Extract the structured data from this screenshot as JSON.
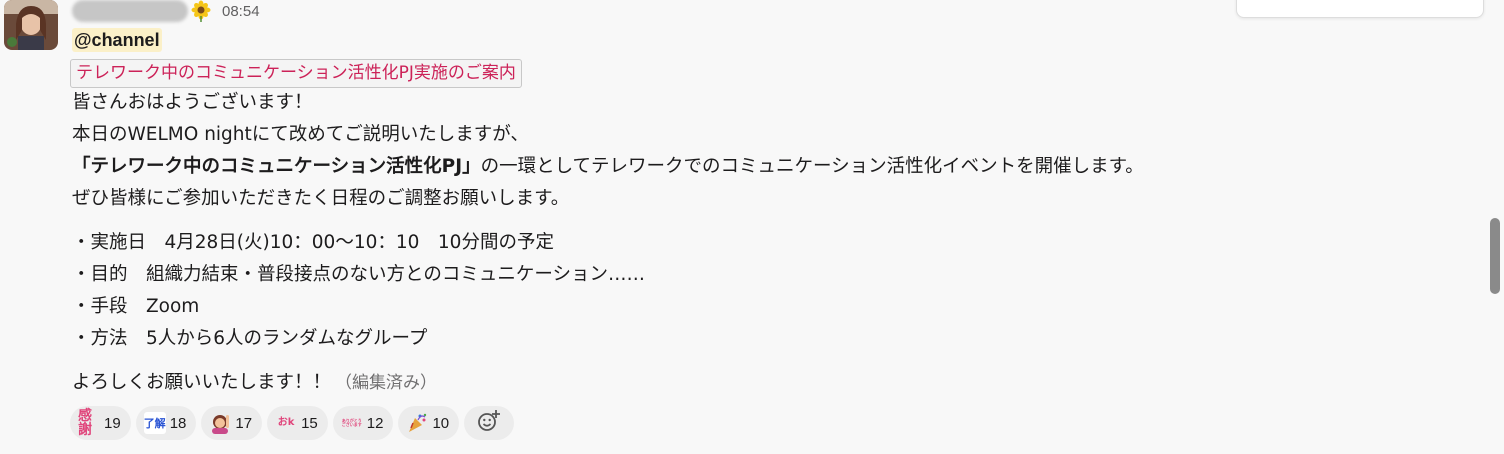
{
  "message": {
    "time": "08:54",
    "mention": "@channel",
    "title_code": "テレワーク中のコミュニケーション活性化PJ実施のご案内",
    "lines": {
      "greeting": "皆さんおはようございます！",
      "intro": "本日のWELMO nightにて改めてご説明いたしますが、",
      "project_bold": "「テレワーク中のコミュニケーション活性化PJ」",
      "project_rest": "の一環としてテレワークでのコミュニケーション活性化イベントを開催します。",
      "request": "ぜひ皆様にご参加いただきたく日程のご調整お願いします。",
      "item_date": "・実施日　4月28日(火)10：00～10：10　10分間の予定",
      "item_purpose": "・目的　組織力結束・普段接点のない方とのコミュニケーション……",
      "item_means": "・手段　Zoom",
      "item_method": "・方法　5人から6人のランダムなグループ",
      "closing": "よろしくお願いいたします！！",
      "edited": "（編集済み）"
    }
  },
  "reactions": [
    {
      "icon": "kansha-emoji",
      "text": "感謝",
      "count": "19",
      "color": "#e0457b"
    },
    {
      "icon": "ryokai-emoji",
      "text": "了解",
      "count": "18",
      "color": "#2b55d4"
    },
    {
      "icon": "person-raising-hand-emoji",
      "text": "",
      "count": "17",
      "color": "#d86f9a"
    },
    {
      "icon": "ok-emoji",
      "text": "おk",
      "count": "15",
      "color": "#e0457b"
    },
    {
      "icon": "arigatou-emoji",
      "text": "ありがとうございます",
      "count": "12",
      "color": "#e0457b"
    },
    {
      "icon": "party-popper-emoji",
      "text": "",
      "count": "10",
      "color": "#e6a23c"
    }
  ],
  "colors": {
    "background": "#f8f8f8",
    "code_text": "#cc2258",
    "mention_bg": "#fbf0c8"
  }
}
